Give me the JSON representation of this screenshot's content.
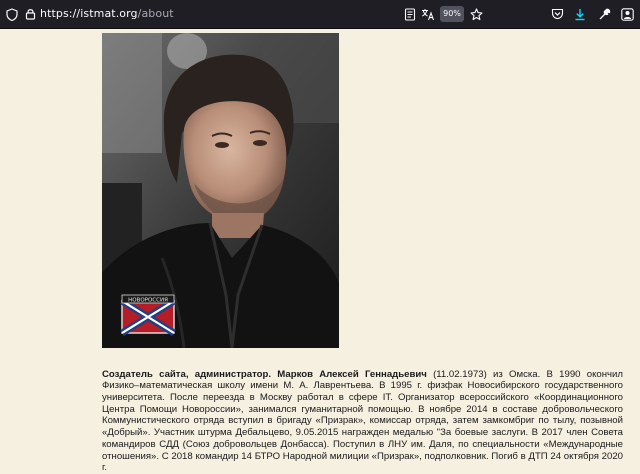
{
  "browser": {
    "url_host": "https://istmat.org",
    "url_path": "/about",
    "zoom": "90%",
    "icons": [
      "shield-icon",
      "lock-icon",
      "reader-view-icon",
      "translate-icon",
      "bookmark-star-icon",
      "pocket-icon",
      "download-icon",
      "extensions-wrench-icon",
      "profile-icon"
    ],
    "colors": {
      "toolbar": "#1f1e25",
      "download_accent": "#00ddff",
      "page_bg": "#f6f0e1"
    }
  },
  "photo": {
    "flag_caption": "НОВОРОССИЯ"
  },
  "bio": {
    "lead": "Создатель сайта, администратор. Марков Алексей Геннадьевич",
    "text": " (11.02.1973) из Омска. В 1990 окончил Физико–математическая школу имени М. А. Лаврентьева. В 1995 г. физфак Новосибирского государственного университета. После переезда в Москву работал в сфере IT. Организатор всероссийского «Координационного Центра Помощи Новороссии», занимался гуманитарной помощью. В ноябре 2014 в составе добровольческого Коммунистического отряда вступил в бригаду «Призрак», комиссар отряда, затем замкомбриг по тылу, позывной «Добрый». Участник штурма Дебальцево, 9.05.2015 награжден медалью \"За боевые заслуги. В 2017 член Совета командиров СДД (Союз добровольцев Донбасса). Поступил в ЛНУ им. Даля, по специальности «Международные отношения». С 2018 командир 14 БТРО Народной милиции «Призрак», подполковник. Погиб в ДТП 24 октября 2020 г."
  }
}
